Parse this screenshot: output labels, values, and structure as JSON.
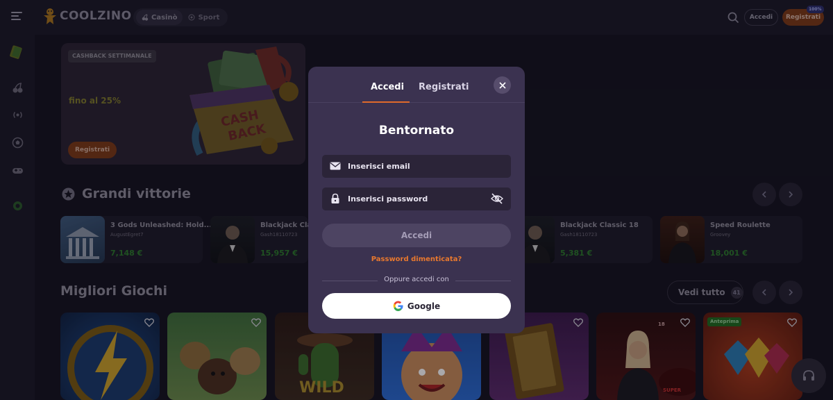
{
  "header": {
    "logo_text": "COOLZINO",
    "tabs": [
      {
        "label": "Casinò",
        "icon": "cherries-icon"
      },
      {
        "label": "Sport",
        "icon": "soccer-ball-icon"
      }
    ],
    "login_label": "Accedi",
    "register_label": "Registrati",
    "register_badge": "100%"
  },
  "sidebar": {
    "icons": [
      "cash-icon",
      "cherries-icon",
      "live-broadcast-icon",
      "soccer-ball-icon",
      "gamepad-icon",
      "poker-chip-icon"
    ]
  },
  "promo": {
    "tag": "CASHBACK SETTIMANALE",
    "text": "fino al 25%",
    "button": "Registrati"
  },
  "big_wins": {
    "title": "Grandi vittorie",
    "items": [
      {
        "game": "3 Gods Unleashed: Hold...",
        "user": "AugustEgret7",
        "amount": "7,148 €"
      },
      {
        "game": "Blackjack Cla",
        "user": "Gash18110723",
        "amount": "15,957 €"
      },
      {
        "game": "Blackjack Classic 18",
        "user": "Gash18110723",
        "amount": "5,381 €"
      },
      {
        "game": "Speed Roulette",
        "user": "Groovey",
        "amount": "18,001 €"
      }
    ]
  },
  "top_games": {
    "title": "Migliori Giochi",
    "see_all": "Vedi tutto",
    "count": "41",
    "badge_preview": "Anteprima",
    "tile_texts": {
      "wild": "WILD",
      "super": "SUPER",
      "num": "18"
    }
  },
  "modal": {
    "tabs": {
      "login": "Accedi",
      "register": "Registrati"
    },
    "title": "Bentornato",
    "email_placeholder": "Inserisci email",
    "password_placeholder": "Inserisci password",
    "submit": "Accedi",
    "forgot": "Password dimenticata?",
    "or_text": "Oppure accedi con",
    "google": "Google"
  },
  "colors": {
    "accent": "#e06a2a",
    "modal_bg": "#3b3250",
    "win_green": "#2c7a2c"
  }
}
